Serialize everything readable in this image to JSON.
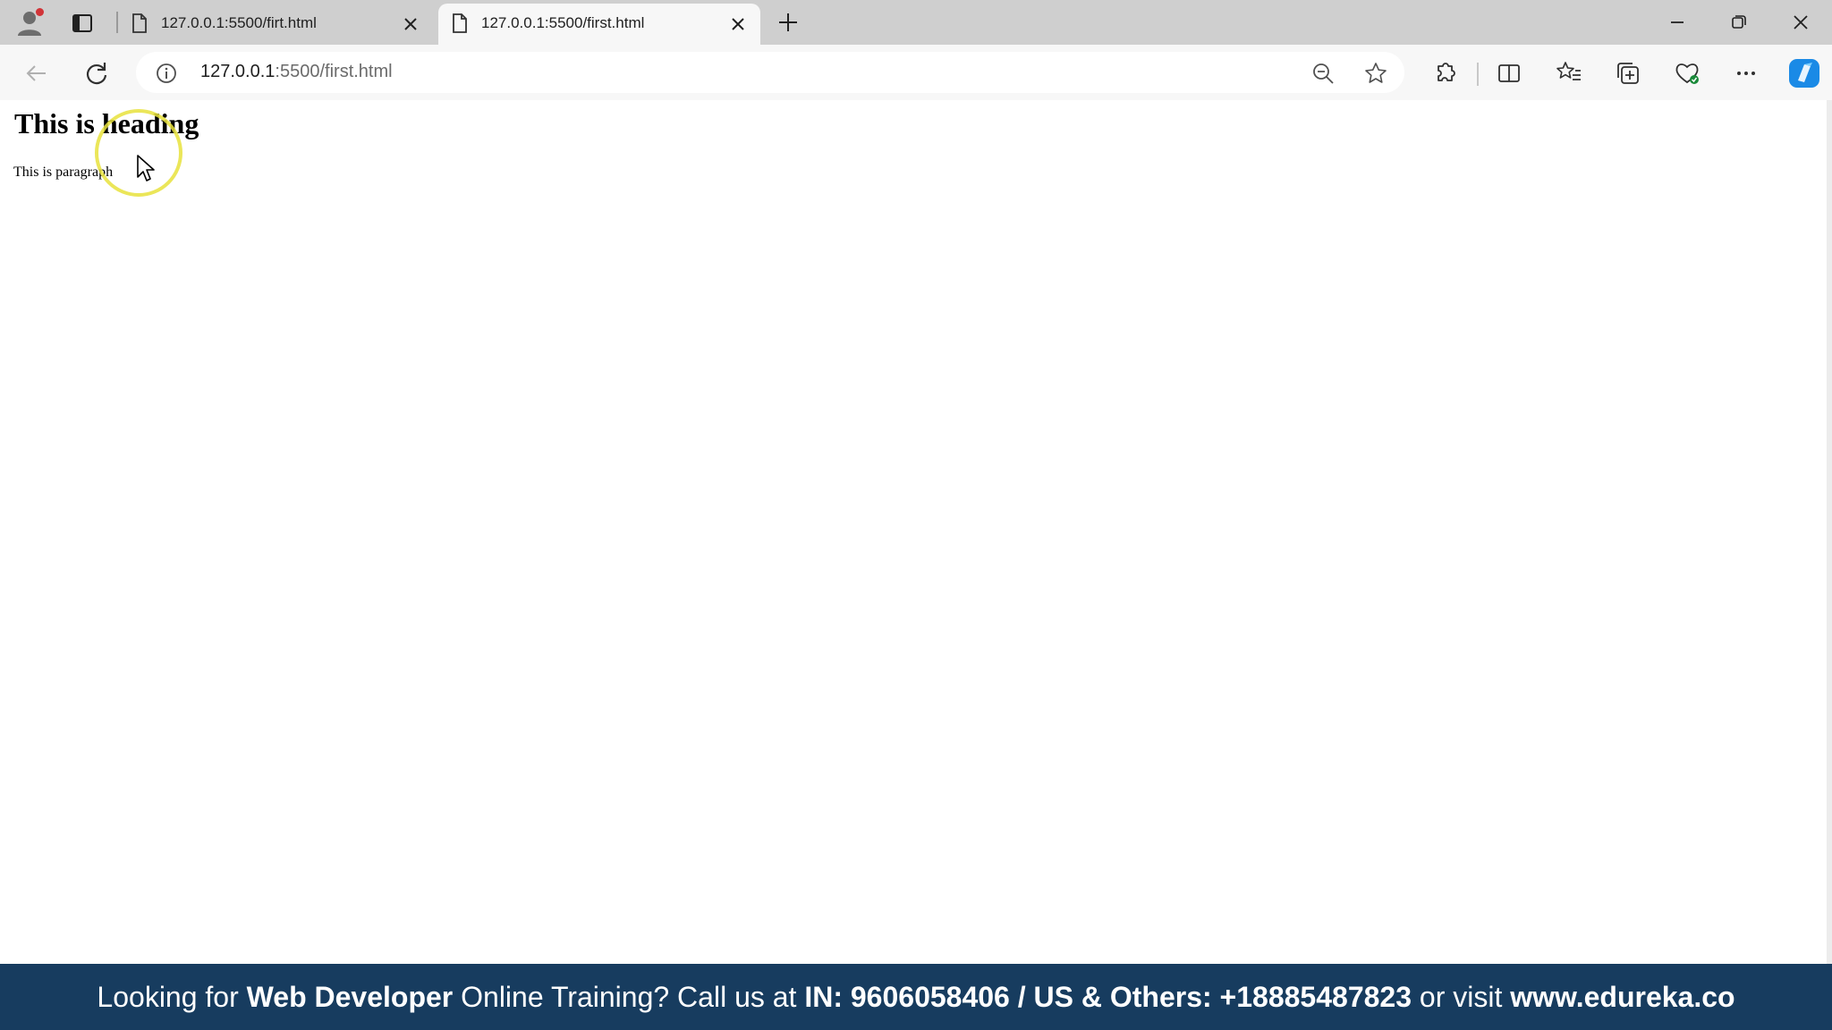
{
  "tabs": [
    {
      "title": "127.0.0.1:5500/firt.html",
      "active": false
    },
    {
      "title": "127.0.0.1:5500/first.html",
      "active": true
    }
  ],
  "address_bar": {
    "host": "127.0.0.1",
    "path": ":5500/first.html"
  },
  "page": {
    "heading": "This is heading",
    "paragraph": "This is paragraph"
  },
  "banner": {
    "part1": "Looking for ",
    "part2": "Web Developer",
    "part3": " Online Training? Call us at ",
    "part4": "IN: 9606058406 / US & Others: +18885487823",
    "part5": " or visit ",
    "part6": "www.edureka.co"
  },
  "colors": {
    "tabstrip": "#cfcfcf",
    "toolbar": "#f7f7f7",
    "banner": "#173c5f",
    "copilot": "#1a8ae6",
    "cursor_highlight": "#e8e23c"
  },
  "icons": [
    "profile-icon",
    "tab-actions-icon",
    "page-icon",
    "close-icon",
    "plus-icon",
    "minimize-icon",
    "restore-icon",
    "back-icon",
    "refresh-icon",
    "info-icon",
    "zoom-out-icon",
    "star-icon",
    "extensions-icon",
    "split-screen-icon",
    "favorites-icon",
    "collections-icon",
    "browser-essentials-icon",
    "more-icon",
    "copilot-icon"
  ]
}
